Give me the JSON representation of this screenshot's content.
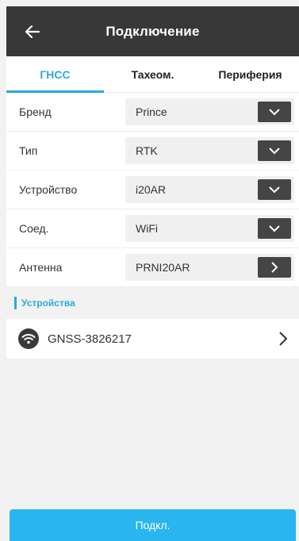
{
  "header": {
    "title": "Подключение",
    "back_icon": "arrow-left-icon"
  },
  "tabs": [
    {
      "label": "ГНСС",
      "active": true
    },
    {
      "label": "Тахеом.",
      "active": false
    },
    {
      "label": "Периферия",
      "active": false
    }
  ],
  "form": {
    "rows": [
      {
        "label": "Бренд",
        "value": "Prince",
        "button_icon": "chevron-down-icon"
      },
      {
        "label": "Тип",
        "value": "RTK",
        "button_icon": "chevron-down-icon"
      },
      {
        "label": "Устройство",
        "value": "i20AR",
        "button_icon": "chevron-down-icon"
      },
      {
        "label": "Соед.",
        "value": "WiFi",
        "button_icon": "chevron-down-icon"
      },
      {
        "label": "Антенна",
        "value": "PRNI20AR",
        "button_icon": "chevron-right-icon"
      }
    ]
  },
  "devices": {
    "section_title": "Устройства",
    "items": [
      {
        "name": "GNSS-3826217",
        "icon": "wifi-icon"
      }
    ]
  },
  "footer": {
    "connect_label": "Подкл."
  },
  "colors": {
    "accent": "#29a8e0",
    "header_bg": "#383838",
    "connect_bg": "#29b6f0"
  }
}
